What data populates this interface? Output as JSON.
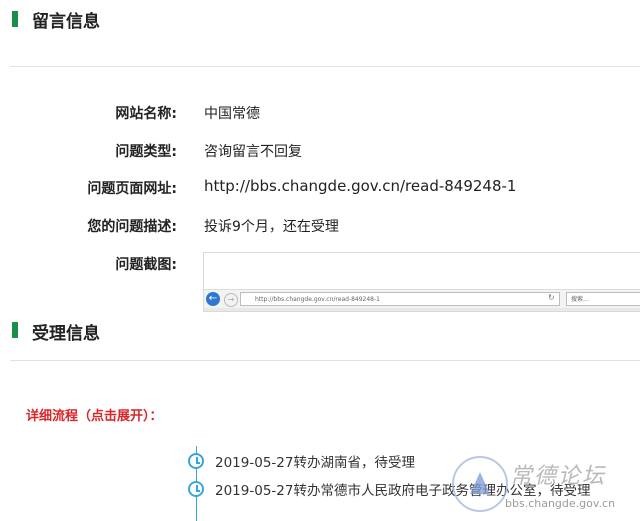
{
  "sections": {
    "message_info_title": "留言信息",
    "acceptance_info_title": "受理信息"
  },
  "fields": [
    {
      "label": "网站名称:",
      "value": "中国常德"
    },
    {
      "label": "问题类型:",
      "value": "咨询留言不回复"
    },
    {
      "label": "问题页面网址:",
      "value": "http://bbs.changde.gov.cn/read-849248-1"
    },
    {
      "label": "您的问题描述:",
      "value": "投诉9个月，还在受理"
    },
    {
      "label": "问题截图:"
    }
  ],
  "screenshot": {
    "address": "http://bbs.changde.gov.cn/read-849248-1",
    "search_placeholder": "搜索..."
  },
  "flow": {
    "toggle_label": "详细流程（点击展开）："
  },
  "timeline": [
    {
      "text": "2019-05-27转办湖南省，待受理"
    },
    {
      "text": "2019-05-27转办常德市人民政府电子政务管理办公室，待受理"
    }
  ],
  "watermark": {
    "name": "常德论坛",
    "url": "bbs.changde.gov.cn"
  },
  "colors": {
    "accent_green": "#1a8f4a",
    "link_red": "#d8262a",
    "timeline_blue": "#3aa6d8"
  }
}
